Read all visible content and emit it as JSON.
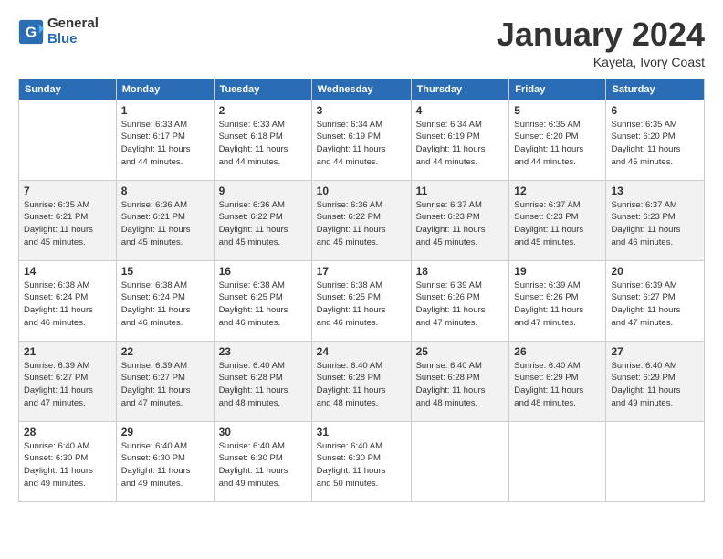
{
  "logo": {
    "general": "General",
    "blue": "Blue"
  },
  "title": "January 2024",
  "location": "Kayeta, Ivory Coast",
  "days_header": [
    "Sunday",
    "Monday",
    "Tuesday",
    "Wednesday",
    "Thursday",
    "Friday",
    "Saturday"
  ],
  "weeks": [
    [
      {
        "day": "",
        "info": ""
      },
      {
        "day": "1",
        "info": "Sunrise: 6:33 AM\nSunset: 6:17 PM\nDaylight: 11 hours\nand 44 minutes."
      },
      {
        "day": "2",
        "info": "Sunrise: 6:33 AM\nSunset: 6:18 PM\nDaylight: 11 hours\nand 44 minutes."
      },
      {
        "day": "3",
        "info": "Sunrise: 6:34 AM\nSunset: 6:19 PM\nDaylight: 11 hours\nand 44 minutes."
      },
      {
        "day": "4",
        "info": "Sunrise: 6:34 AM\nSunset: 6:19 PM\nDaylight: 11 hours\nand 44 minutes."
      },
      {
        "day": "5",
        "info": "Sunrise: 6:35 AM\nSunset: 6:20 PM\nDaylight: 11 hours\nand 44 minutes."
      },
      {
        "day": "6",
        "info": "Sunrise: 6:35 AM\nSunset: 6:20 PM\nDaylight: 11 hours\nand 45 minutes."
      }
    ],
    [
      {
        "day": "7",
        "info": "Sunrise: 6:35 AM\nSunset: 6:21 PM\nDaylight: 11 hours\nand 45 minutes."
      },
      {
        "day": "8",
        "info": "Sunrise: 6:36 AM\nSunset: 6:21 PM\nDaylight: 11 hours\nand 45 minutes."
      },
      {
        "day": "9",
        "info": "Sunrise: 6:36 AM\nSunset: 6:22 PM\nDaylight: 11 hours\nand 45 minutes."
      },
      {
        "day": "10",
        "info": "Sunrise: 6:36 AM\nSunset: 6:22 PM\nDaylight: 11 hours\nand 45 minutes."
      },
      {
        "day": "11",
        "info": "Sunrise: 6:37 AM\nSunset: 6:23 PM\nDaylight: 11 hours\nand 45 minutes."
      },
      {
        "day": "12",
        "info": "Sunrise: 6:37 AM\nSunset: 6:23 PM\nDaylight: 11 hours\nand 45 minutes."
      },
      {
        "day": "13",
        "info": "Sunrise: 6:37 AM\nSunset: 6:23 PM\nDaylight: 11 hours\nand 46 minutes."
      }
    ],
    [
      {
        "day": "14",
        "info": "Sunrise: 6:38 AM\nSunset: 6:24 PM\nDaylight: 11 hours\nand 46 minutes."
      },
      {
        "day": "15",
        "info": "Sunrise: 6:38 AM\nSunset: 6:24 PM\nDaylight: 11 hours\nand 46 minutes."
      },
      {
        "day": "16",
        "info": "Sunrise: 6:38 AM\nSunset: 6:25 PM\nDaylight: 11 hours\nand 46 minutes."
      },
      {
        "day": "17",
        "info": "Sunrise: 6:38 AM\nSunset: 6:25 PM\nDaylight: 11 hours\nand 46 minutes."
      },
      {
        "day": "18",
        "info": "Sunrise: 6:39 AM\nSunset: 6:26 PM\nDaylight: 11 hours\nand 47 minutes."
      },
      {
        "day": "19",
        "info": "Sunrise: 6:39 AM\nSunset: 6:26 PM\nDaylight: 11 hours\nand 47 minutes."
      },
      {
        "day": "20",
        "info": "Sunrise: 6:39 AM\nSunset: 6:27 PM\nDaylight: 11 hours\nand 47 minutes."
      }
    ],
    [
      {
        "day": "21",
        "info": "Sunrise: 6:39 AM\nSunset: 6:27 PM\nDaylight: 11 hours\nand 47 minutes."
      },
      {
        "day": "22",
        "info": "Sunrise: 6:39 AM\nSunset: 6:27 PM\nDaylight: 11 hours\nand 47 minutes."
      },
      {
        "day": "23",
        "info": "Sunrise: 6:40 AM\nSunset: 6:28 PM\nDaylight: 11 hours\nand 48 minutes."
      },
      {
        "day": "24",
        "info": "Sunrise: 6:40 AM\nSunset: 6:28 PM\nDaylight: 11 hours\nand 48 minutes."
      },
      {
        "day": "25",
        "info": "Sunrise: 6:40 AM\nSunset: 6:28 PM\nDaylight: 11 hours\nand 48 minutes."
      },
      {
        "day": "26",
        "info": "Sunrise: 6:40 AM\nSunset: 6:29 PM\nDaylight: 11 hours\nand 48 minutes."
      },
      {
        "day": "27",
        "info": "Sunrise: 6:40 AM\nSunset: 6:29 PM\nDaylight: 11 hours\nand 49 minutes."
      }
    ],
    [
      {
        "day": "28",
        "info": "Sunrise: 6:40 AM\nSunset: 6:30 PM\nDaylight: 11 hours\nand 49 minutes."
      },
      {
        "day": "29",
        "info": "Sunrise: 6:40 AM\nSunset: 6:30 PM\nDaylight: 11 hours\nand 49 minutes."
      },
      {
        "day": "30",
        "info": "Sunrise: 6:40 AM\nSunset: 6:30 PM\nDaylight: 11 hours\nand 49 minutes."
      },
      {
        "day": "31",
        "info": "Sunrise: 6:40 AM\nSunset: 6:30 PM\nDaylight: 11 hours\nand 50 minutes."
      },
      {
        "day": "",
        "info": ""
      },
      {
        "day": "",
        "info": ""
      },
      {
        "day": "",
        "info": ""
      }
    ]
  ]
}
